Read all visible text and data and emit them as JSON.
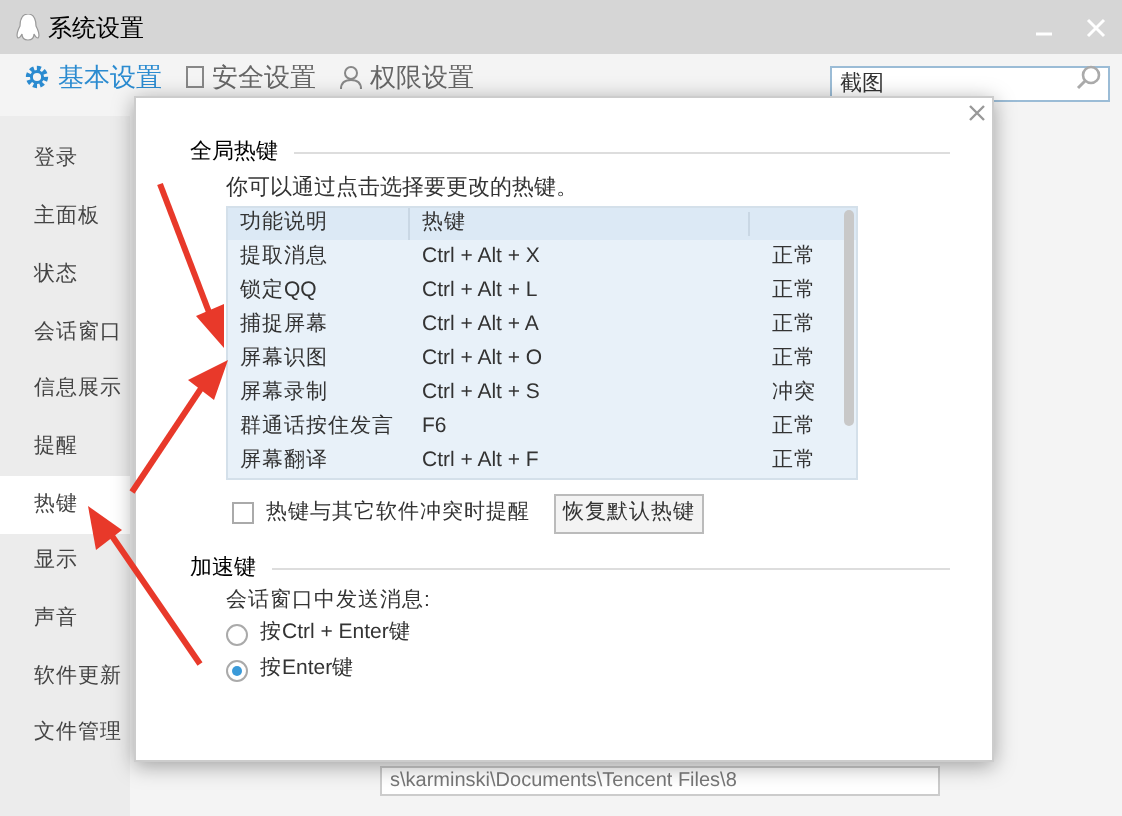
{
  "window": {
    "title": "系统设置"
  },
  "tabs": [
    {
      "label": "基本设置",
      "selected": true
    },
    {
      "label": "安全设置",
      "selected": false
    },
    {
      "label": "权限设置",
      "selected": false
    }
  ],
  "search": {
    "value": "截图"
  },
  "sidebar": {
    "items": [
      {
        "label": "登录",
        "selected": false
      },
      {
        "label": "主面板",
        "selected": false
      },
      {
        "label": "状态",
        "selected": false
      },
      {
        "label": "会话窗口",
        "selected": false
      },
      {
        "label": "信息展示",
        "selected": false
      },
      {
        "label": "提醒",
        "selected": false
      },
      {
        "label": "热键",
        "selected": true
      },
      {
        "label": "显示",
        "selected": false
      },
      {
        "label": "声音",
        "selected": false
      },
      {
        "label": "软件更新",
        "selected": false
      },
      {
        "label": "文件管理",
        "selected": false
      }
    ]
  },
  "dialog": {
    "section_1": "全局热键",
    "instruction": "你可以通过点击选择要更改的热键。",
    "table": {
      "columns": [
        "功能说明",
        "热键"
      ],
      "rows": [
        {
          "name": "提取消息",
          "hotkey": "Ctrl + Alt + X",
          "status": "正常"
        },
        {
          "name": "锁定QQ",
          "hotkey": "Ctrl + Alt + L",
          "status": "正常"
        },
        {
          "name": "捕捉屏幕",
          "hotkey": "Ctrl + Alt + A",
          "status": "正常"
        },
        {
          "name": "屏幕识图",
          "hotkey": "Ctrl + Alt + O",
          "status": "正常"
        },
        {
          "name": "屏幕录制",
          "hotkey": "Ctrl + Alt + S",
          "status": "冲突"
        },
        {
          "name": "群通话按住发言",
          "hotkey": "F6",
          "status": "正常"
        },
        {
          "name": "屏幕翻译",
          "hotkey": "Ctrl + Alt + F",
          "status": "正常"
        }
      ]
    },
    "conflict_reminder": {
      "label": "热键与其它软件冲突时提醒",
      "checked": false
    },
    "restore_button": "恢复默认热键",
    "section_2": "加速键",
    "send_label": "会话窗口中发送消息:",
    "send_options": [
      {
        "label": "按Ctrl + Enter键",
        "selected": false
      },
      {
        "label": "按Enter键",
        "selected": true
      }
    ]
  },
  "path_field": {
    "value": "s\\karminski\\Documents\\Tencent Files\\8"
  }
}
